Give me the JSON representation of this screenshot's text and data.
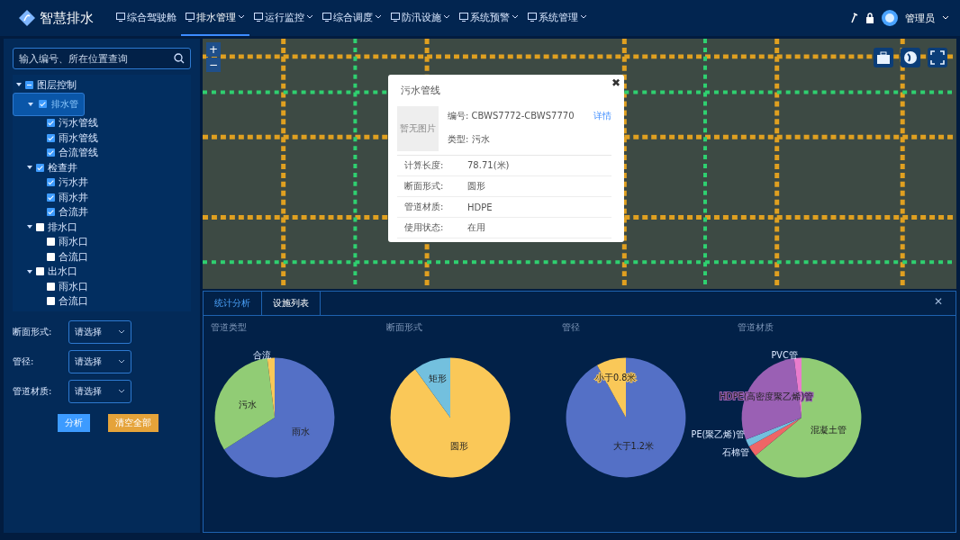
{
  "header": {
    "logo_text": "智慧排水",
    "nav": [
      {
        "label": "综合驾驶舱",
        "selected": false,
        "dropdown": false
      },
      {
        "label": "排水管理",
        "selected": true,
        "dropdown": true
      },
      {
        "label": "运行监控",
        "selected": false,
        "dropdown": true
      },
      {
        "label": "综合调度",
        "selected": false,
        "dropdown": true
      },
      {
        "label": "防汛设施",
        "selected": false,
        "dropdown": true
      },
      {
        "label": "系统预警",
        "selected": false,
        "dropdown": true
      },
      {
        "label": "系统管理",
        "selected": false,
        "dropdown": true
      }
    ],
    "user": "管理员"
  },
  "sidebar": {
    "search": {
      "placeholder": "输入编号、所在位置查询"
    },
    "tree": [
      {
        "label": "图层控制",
        "checked": true,
        "partial": true,
        "expanded": true,
        "selected": false,
        "children": [
          {
            "label": "排水管",
            "checked": true,
            "expanded": true,
            "selected": true,
            "children": [
              {
                "label": "污水管线",
                "checked": true,
                "selected": false
              },
              {
                "label": "雨水管线",
                "checked": true,
                "selected": false
              },
              {
                "label": "合流管线",
                "checked": true,
                "selected": false
              }
            ]
          },
          {
            "label": "检查井",
            "checked": true,
            "expanded": true,
            "selected": false,
            "children": [
              {
                "label": "污水井",
                "checked": true,
                "selected": false
              },
              {
                "label": "雨水井",
                "checked": true,
                "selected": false
              },
              {
                "label": "合流井",
                "checked": true,
                "selected": false
              }
            ]
          },
          {
            "label": "排水口",
            "checked": false,
            "expanded": true,
            "selected": false,
            "children": [
              {
                "label": "雨水口",
                "checked": false,
                "selected": false
              },
              {
                "label": "合流口",
                "checked": false,
                "selected": false
              }
            ]
          },
          {
            "label": "出水口",
            "checked": false,
            "expanded": true,
            "selected": false,
            "children": [
              {
                "label": "雨水口",
                "checked": false,
                "selected": false
              },
              {
                "label": "合流口",
                "checked": false,
                "selected": false
              }
            ]
          }
        ]
      }
    ],
    "filters": [
      {
        "label": "断面形式:",
        "placeholder": "请选择"
      },
      {
        "label": "管径:",
        "placeholder": "请选择"
      },
      {
        "label": "管道材质:",
        "placeholder": "请选择"
      }
    ],
    "buttons": [
      {
        "label": "分析",
        "kind": "primary"
      },
      {
        "label": "清空全部",
        "kind": "warning"
      }
    ]
  },
  "map": {
    "zoom_in": "+",
    "zoom_out": "−"
  },
  "popup": {
    "title": "污水管线",
    "image_text": "暂无图片",
    "code_label": "编号:",
    "code": "CBWS7772-CBWS7770",
    "detail_link": "详情",
    "type_label": "类型:",
    "type": "污水",
    "close": "✖",
    "fields": [
      {
        "label": "计算长度:",
        "value": "78.71(米)"
      },
      {
        "label": "断面形式:",
        "value": "圆形"
      },
      {
        "label": "管道材质:",
        "value": "HDPE"
      },
      {
        "label": "使用状态:",
        "value": "在用"
      }
    ]
  },
  "bottom_panel": {
    "tabs": [
      {
        "label": "统计分析",
        "selected": true
      },
      {
        "label": "设施列表",
        "selected": false
      }
    ],
    "close": "✕",
    "charts": [
      {
        "chart_data": {
          "type": "pie",
          "title": "管道类型",
          "categories": [
            "雨水",
            "污水",
            "合流"
          ],
          "values": [
            66,
            32,
            2
          ],
          "colors": [
            "#5470c6",
            "#91cc75",
            "#fac858"
          ]
        }
      },
      {
        "chart_data": {
          "type": "pie",
          "title": "断面形式",
          "categories": [
            "圆形",
            "矩形"
          ],
          "values": [
            90,
            10
          ],
          "colors": [
            "#fac858",
            "#73c0de"
          ]
        }
      },
      {
        "chart_data": {
          "type": "pie",
          "title": "管径",
          "categories": [
            "大于1.2米",
            "小于0.8米"
          ],
          "values": [
            92,
            8
          ],
          "colors": [
            "#5470c6",
            "#fac858"
          ]
        }
      },
      {
        "chart_data": {
          "type": "pie",
          "title": "管道材质",
          "categories": [
            "混凝土管",
            "石棉管",
            "PE(聚乙烯)管",
            "HDPE(高密度聚乙烯)管",
            "PVC管"
          ],
          "values": [
            64,
            3,
            2,
            29,
            2
          ],
          "colors": [
            "#91cc75",
            "#ee6666",
            "#73c0de",
            "#9a60b4",
            "#ea7ccc"
          ]
        }
      }
    ]
  }
}
